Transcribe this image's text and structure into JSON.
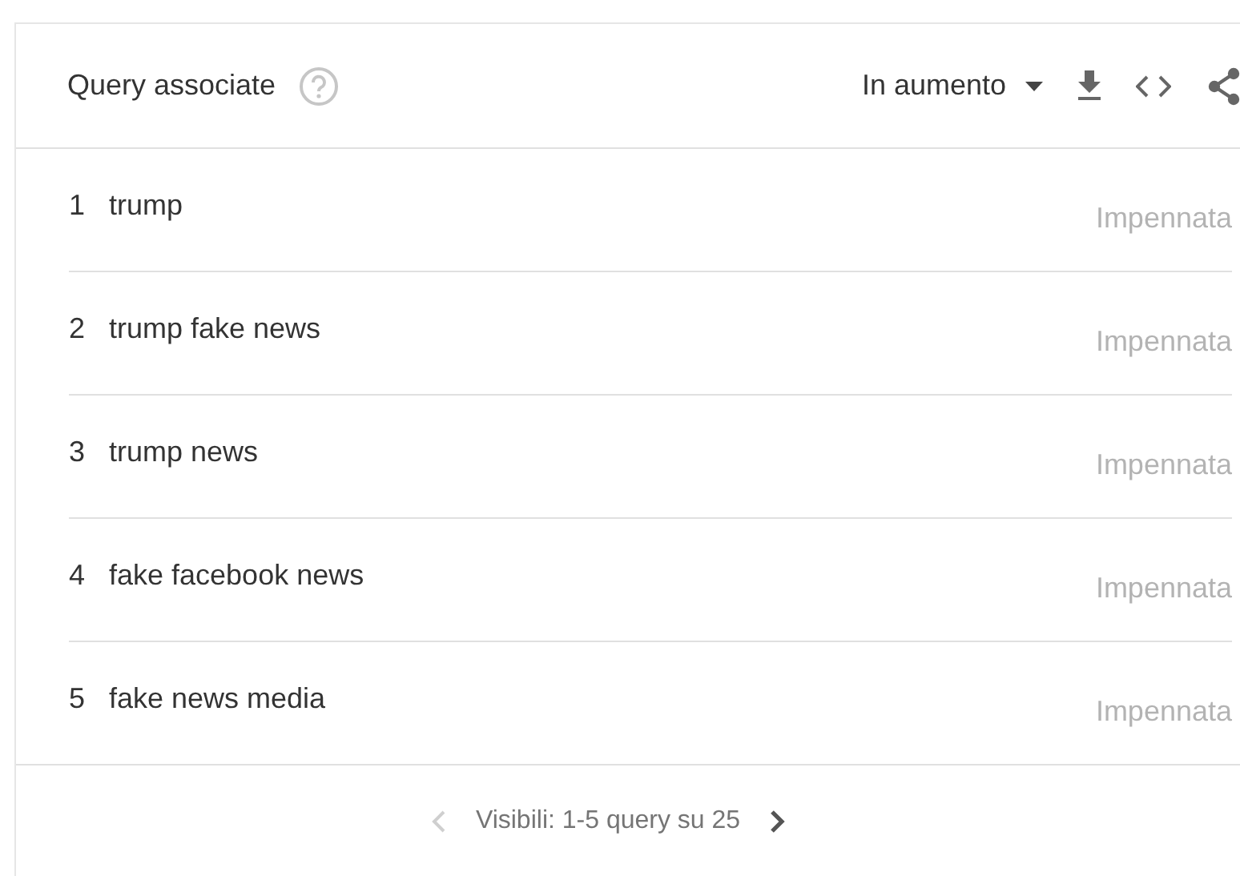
{
  "header": {
    "title": "Query associate",
    "sort": "In aumento"
  },
  "rows": [
    {
      "rank": "1",
      "query": "trump",
      "value": "Impennata"
    },
    {
      "rank": "2",
      "query": "trump fake news",
      "value": "Impennata"
    },
    {
      "rank": "3",
      "query": "trump news",
      "value": "Impennata"
    },
    {
      "rank": "4",
      "query": "fake facebook news",
      "value": "Impennata"
    },
    {
      "rank": "5",
      "query": "fake news media",
      "value": "Impennata"
    }
  ],
  "pager": {
    "label": "Visibili: 1-5 query su 25",
    "prev_disabled": true,
    "next_disabled": false
  }
}
